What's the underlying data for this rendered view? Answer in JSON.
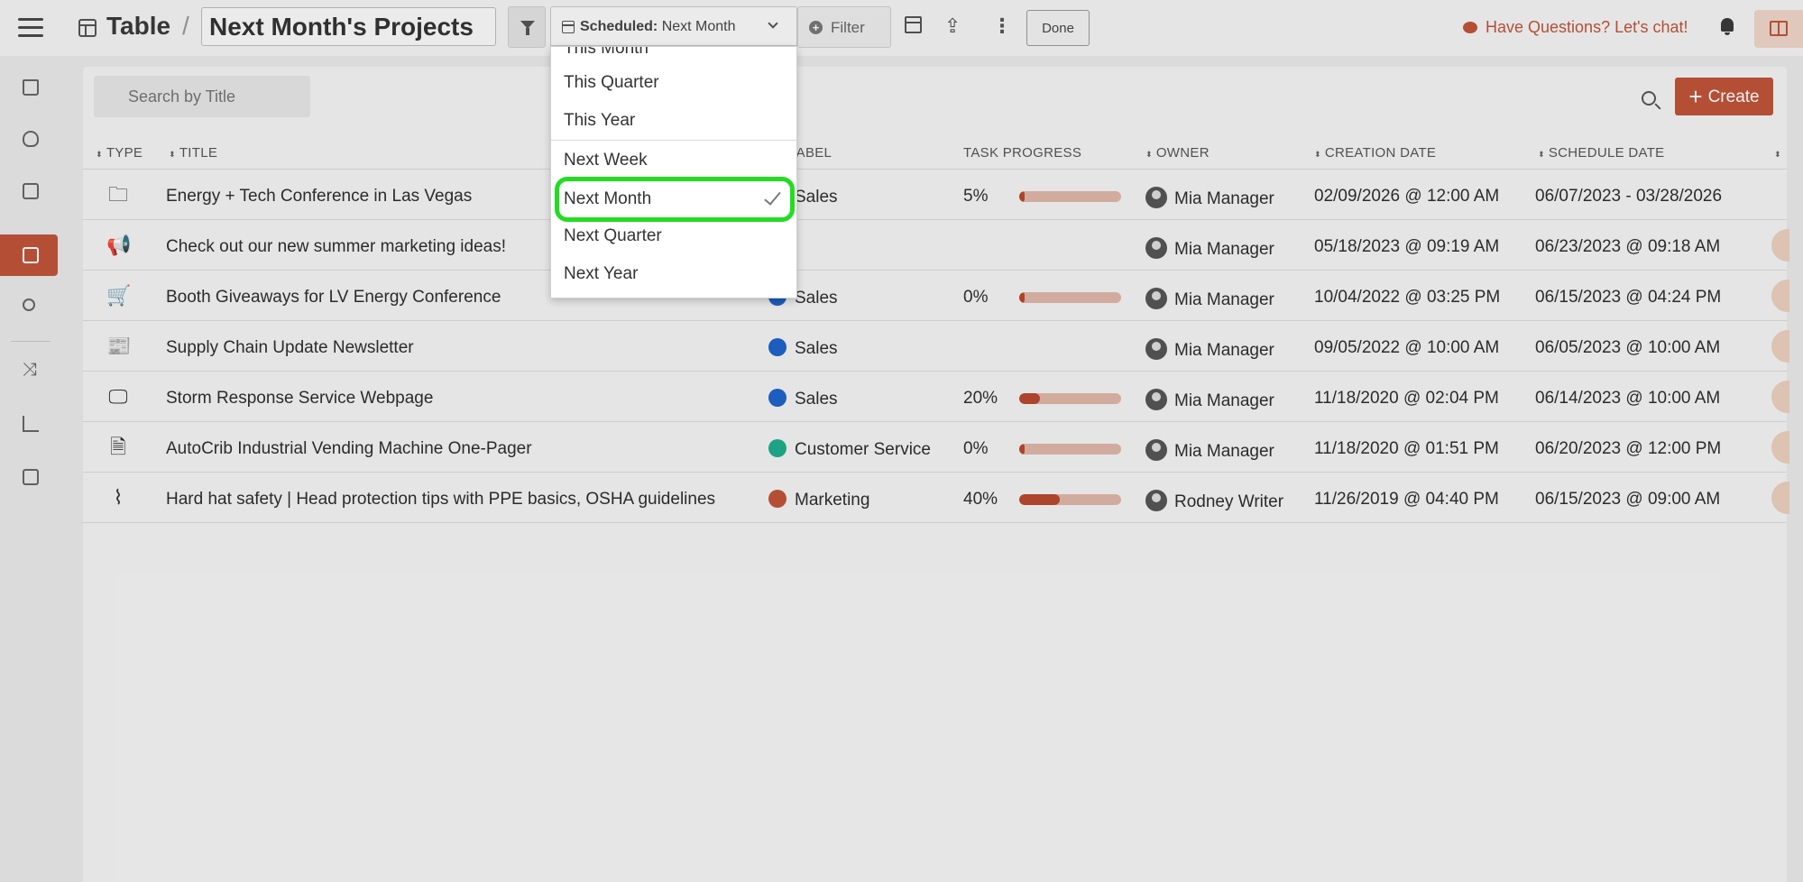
{
  "header": {
    "breadcrumb_root": "Table",
    "separator": "/",
    "view_title": "Next Month's Projects",
    "scheduled_label": "Scheduled:",
    "scheduled_value": "Next Month",
    "filter_label": "Filter",
    "done_label": "Done",
    "chat_label": "Have Questions? Let's chat!",
    "share_glyph": "⇪",
    "dots_glyph": "⋮"
  },
  "sidebar": {
    "items": [
      {
        "icon": "home-icon"
      },
      {
        "icon": "bulb-icon"
      },
      {
        "icon": "calendar-icon"
      },
      {
        "icon": "table-icon",
        "active": true
      },
      {
        "icon": "people-icon"
      },
      {
        "icon": "shuffle-icon",
        "glyph": "⤨"
      },
      {
        "icon": "chart-icon"
      },
      {
        "icon": "briefcase-icon"
      }
    ]
  },
  "toolbar": {
    "search_placeholder": "Search by Title",
    "create_label": "Create",
    "create_plus": "+"
  },
  "table": {
    "columns": {
      "type": "TYPE",
      "title": "TITLE",
      "label": "LABEL",
      "task_progress": "TASK PROGRESS",
      "owner": "OWNER",
      "creation_date": "CREATION DATE",
      "schedule_date": "SCHEDULE DATE"
    },
    "rows": [
      {
        "type_icon": "folder-icon",
        "glyph": "🗀",
        "title": "Energy + Tech Conference in Las Vegas",
        "label": "Sales",
        "label_color": "#1e63c9",
        "progress": "5%",
        "progress_value": 5,
        "owner": "Mia Manager",
        "created": "02/09/2026 @ 12:00 AM",
        "scheduled": "06/07/2023 - 03/28/2026"
      },
      {
        "type_icon": "megaphone-icon",
        "glyph": "📢",
        "title": "Check out our new summer marketing ideas!",
        "label": "",
        "label_color": "",
        "progress": "",
        "progress_value": null,
        "owner": "Mia Manager",
        "created": "05/18/2023 @ 09:19 AM",
        "scheduled": "06/23/2023 @ 09:18 AM"
      },
      {
        "type_icon": "cart-icon",
        "glyph": "🛒",
        "title": "Booth Giveaways for LV Energy Conference",
        "label": "Sales",
        "label_color": "#1e63c9",
        "progress": "0%",
        "progress_value": 0,
        "owner": "Mia Manager",
        "created": "10/04/2022 @ 03:25 PM",
        "scheduled": "06/15/2023 @ 04:24 PM"
      },
      {
        "type_icon": "newsletter-icon",
        "glyph": "📰",
        "title": "Supply Chain Update Newsletter",
        "label": "Sales",
        "label_color": "#1e63c9",
        "progress": "",
        "progress_value": null,
        "owner": "Mia Manager",
        "created": "09/05/2022 @ 10:00 AM",
        "scheduled": "06/05/2023 @ 10:00 AM"
      },
      {
        "type_icon": "monitor-icon",
        "glyph": "🖵",
        "title": "Storm Response Service Webpage",
        "label": "Sales",
        "label_color": "#1e63c9",
        "progress": "20%",
        "progress_value": 20,
        "owner": "Mia Manager",
        "created": "11/18/2020 @ 02:04 PM",
        "scheduled": "06/14/2023 @ 10:00 AM"
      },
      {
        "type_icon": "document-icon",
        "glyph": "🗎",
        "title": "AutoCrib Industrial Vending Machine One-Pager",
        "label": "Customer Service",
        "label_color": "#1fae8c",
        "progress": "0%",
        "progress_value": 0,
        "owner": "Mia Manager",
        "created": "11/18/2020 @ 01:51 PM",
        "scheduled": "06/20/2023 @ 12:00 PM"
      },
      {
        "type_icon": "rss-icon",
        "glyph": "⌇",
        "title": "Hard hat safety | Head protection tips with PPE basics, OSHA guidelines",
        "label": "Marketing",
        "label_color": "#c0543a",
        "progress": "40%",
        "progress_value": 40,
        "owner": "Rodney Writer",
        "created": "11/26/2019 @ 04:40 PM",
        "scheduled": "06/15/2023 @ 09:00 AM"
      }
    ]
  },
  "dropdown": {
    "partial_top": "This Month",
    "options": [
      "This Quarter",
      "This Year",
      "Next Week",
      "Next Month",
      "Next Quarter",
      "Next Year"
    ],
    "selected": "Next Month",
    "highlight_color": "#22dd22"
  },
  "colors": {
    "accent": "#c0543a",
    "sales": "#1e63c9",
    "customer_service": "#1fae8c",
    "marketing": "#c0543a"
  }
}
